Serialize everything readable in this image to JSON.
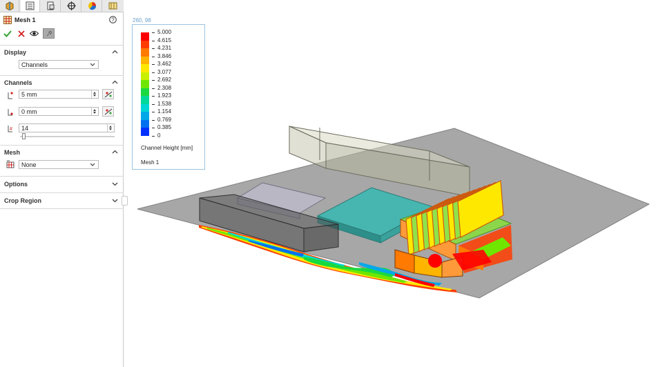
{
  "panel": {
    "title": "Mesh 1",
    "help_icon": "help-icon",
    "tabs": [
      "feature-manager-icon",
      "property-manager-icon",
      "configuration-manager-icon",
      "dimxpert-icon",
      "display-manager-icon",
      "simulation-icon"
    ],
    "actions": {
      "ok": "check-icon",
      "cancel": "close-icon",
      "preview": "eye-icon",
      "pin": "pushpin-icon"
    },
    "display": {
      "label": "Display",
      "mode": "Channels"
    },
    "channels": {
      "label": "Channels",
      "max_height": "5 mm",
      "min_height": "0 mm",
      "count": "14",
      "slider_value": 0.02
    },
    "mesh": {
      "label": "Mesh",
      "selection": "None"
    },
    "options": {
      "label": "Options"
    },
    "crop_region": {
      "label": "Crop Region"
    }
  },
  "legend": {
    "coord": "260, 98",
    "ticks": [
      "5.000",
      "4.615",
      "4.231",
      "3.846",
      "3.462",
      "3.077",
      "2.692",
      "2.308",
      "1.923",
      "1.538",
      "1.154",
      "0.769",
      "0.385",
      "0"
    ],
    "quantity": "Channel Height [mm]",
    "mesh_name": "Mesh 1",
    "colors": [
      "#ff0000",
      "#ff3c00",
      "#ff7a00",
      "#ffb400",
      "#ffe800",
      "#c8f000",
      "#6ee600",
      "#19d940",
      "#00d99a",
      "#00d5d5",
      "#00a8e8",
      "#0070f0",
      "#0030ff"
    ]
  },
  "colors": {
    "board": "#a7a7a7",
    "accent_blue": "#6a9fcb"
  }
}
